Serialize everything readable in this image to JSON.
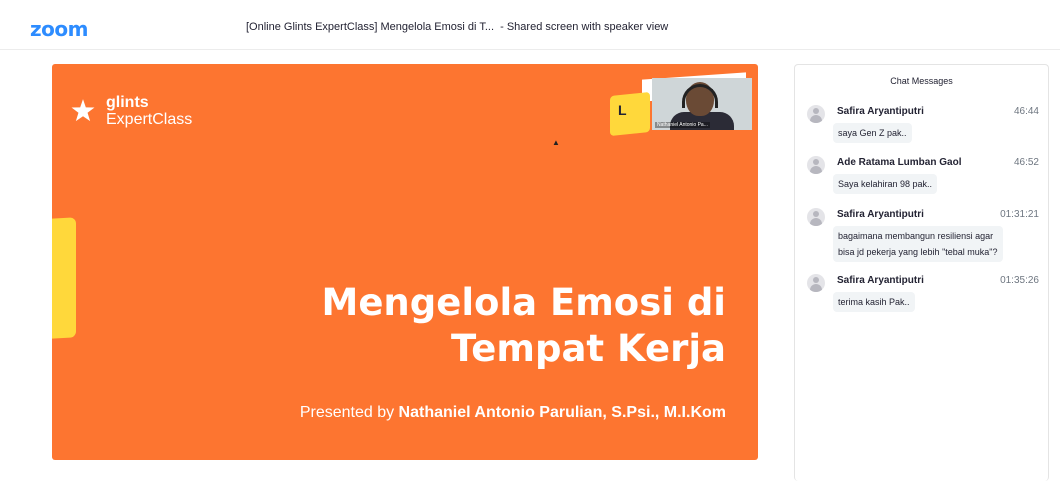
{
  "app": {
    "logo": "zoom",
    "window_title": "[Online Glints ExpertClass] Mengelola Emosi di T...  - Shared screen with speaker view"
  },
  "slide": {
    "brand_line1": "glints",
    "brand_line2": "ExpertClass",
    "title_line1": "Mengelola Emosi di",
    "title_line2": "Tempat Kerja",
    "presenter_prefix": "Presented by ",
    "presenter_name": "Nathaniel Antonio Parulian, S.Psi., M.I.Kom",
    "accent_color": "#fd7530",
    "highlight_color": "#ffd83b"
  },
  "speaker": {
    "name_label": "Nathaniel Antonio Pa...",
    "thumb_letter": "L",
    "mini_brand": "glints ExpertClass"
  },
  "chat": {
    "header": "Chat Messages",
    "messages": [
      {
        "sender": "Safira Aryantiputri",
        "time": "46:44",
        "lines": [
          "saya Gen Z pak.."
        ]
      },
      {
        "sender": "Ade Ratama Lumban Gaol",
        "time": "46:52",
        "lines": [
          "Saya kelahiran 98 pak.."
        ]
      },
      {
        "sender": "Safira Aryantiputri",
        "time": "01:31:21",
        "lines": [
          "bagaimana membangun resiliensi agar",
          "bisa jd pekerja yang lebih \"tebal muka\"?"
        ]
      },
      {
        "sender": "Safira Aryantiputri",
        "time": "01:35:26",
        "lines": [
          "terima kasih Pak.."
        ]
      }
    ]
  }
}
